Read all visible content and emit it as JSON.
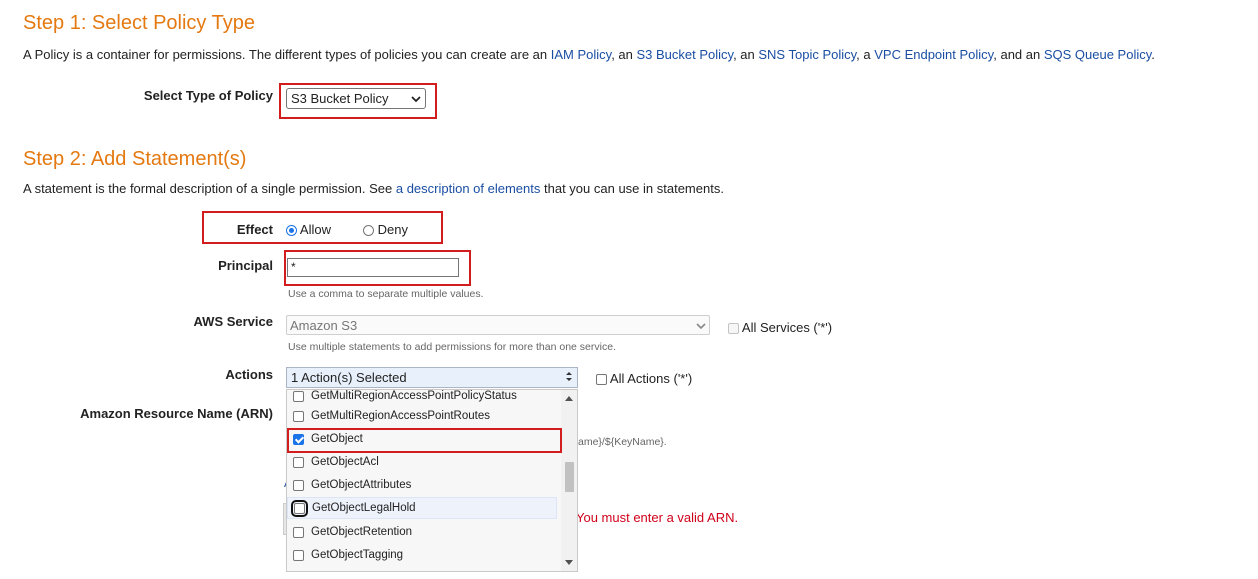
{
  "step1": {
    "title": "Step 1: Select Policy Type",
    "description_parts": {
      "p1": "A Policy is a container for permissions. The different types of policies you can create are an ",
      "link_iam": "IAM Policy",
      "p2": ", an ",
      "link_s3": "S3 Bucket Policy",
      "p3": ", an ",
      "link_sns": "SNS Topic Policy",
      "p4": ", a ",
      "link_vpc": "VPC Endpoint Policy",
      "p5": ", and an ",
      "link_sqs": "SQS Queue Policy",
      "p6": "."
    },
    "policy_type_label": "Select Type of Policy",
    "policy_type_value": "S3 Bucket Policy"
  },
  "step2": {
    "title": "Step 2: Add Statement(s)",
    "description_parts": {
      "p1": "A statement is the formal description of a single permission. See ",
      "link": "a description of elements",
      "p2": " that you can use in statements."
    },
    "effect": {
      "label": "Effect",
      "options": [
        {
          "label": "Allow",
          "selected": true
        },
        {
          "label": "Deny",
          "selected": false
        }
      ]
    },
    "principal": {
      "label": "Principal",
      "value": "*",
      "hint": "Use a comma to separate multiple values."
    },
    "aws_service": {
      "label": "AWS Service",
      "value": "Amazon S3",
      "hint": "Use multiple statements to add permissions for more than one service.",
      "all_services_label": "All Services ('*')",
      "all_services_checked": false
    },
    "actions": {
      "label": "Actions",
      "value": "1 Action(s) Selected",
      "all_actions_label": "All Actions ('*')",
      "all_actions_checked": false,
      "dropdown_items": [
        {
          "label": "GetMultiRegionAccessPointPolicyStatus",
          "checked": false
        },
        {
          "label": "GetMultiRegionAccessPointRoutes",
          "checked": false
        },
        {
          "label": "GetObject",
          "checked": true
        },
        {
          "label": "GetObjectAcl",
          "checked": false
        },
        {
          "label": "GetObjectAttributes",
          "checked": false
        },
        {
          "label": "GetObjectLegalHold",
          "checked": false
        },
        {
          "label": "GetObjectRetention",
          "checked": false
        },
        {
          "label": "GetObjectTagging",
          "checked": false
        }
      ]
    },
    "arn": {
      "label": "Amazon Resource Name (ARN)",
      "hint_fragment": "ame}/${KeyName}.",
      "error": "You must enter a valid ARN."
    }
  }
}
